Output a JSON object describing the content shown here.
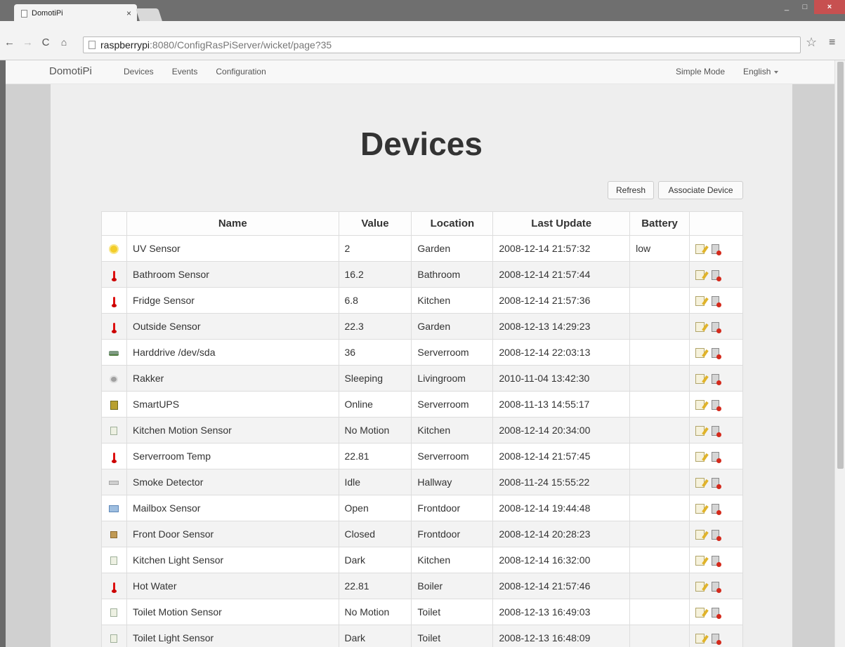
{
  "browser": {
    "tab_title": "DomotiPi",
    "tab_close": "×",
    "url_host": "raspberrypi",
    "url_rest": ":8080/ConfigRasPiServer/wicket/page?35",
    "window_close": "×",
    "window_minimize": "_",
    "window_maximize": "□"
  },
  "navbar": {
    "brand": "DomotiPi",
    "left_items": [
      "Devices",
      "Events",
      "Configuration"
    ],
    "simple_mode": "Simple Mode",
    "language": "English"
  },
  "page": {
    "title": "Devices",
    "refresh_label": "Refresh",
    "associate_label": "Associate Device"
  },
  "table": {
    "headers": {
      "name": "Name",
      "value": "Value",
      "location": "Location",
      "last_update": "Last Update",
      "battery": "Battery"
    },
    "rows": [
      {
        "icon": "sun-icon",
        "name": "UV Sensor",
        "value": "2",
        "location": "Garden",
        "last_update": "2008-12-14 21:57:32",
        "battery": "low"
      },
      {
        "icon": "thermometer-icon",
        "name": "Bathroom Sensor",
        "value": "16.2",
        "location": "Bathroom",
        "last_update": "2008-12-14 21:57:44",
        "battery": ""
      },
      {
        "icon": "thermometer-icon",
        "name": "Fridge Sensor",
        "value": "6.8",
        "location": "Kitchen",
        "last_update": "2008-12-14 21:57:36",
        "battery": ""
      },
      {
        "icon": "thermometer-icon",
        "name": "Outside Sensor",
        "value": "22.3",
        "location": "Garden",
        "last_update": "2008-12-13 14:29:23",
        "battery": ""
      },
      {
        "icon": "harddrive-icon",
        "name": "Harddrive /dev/sda",
        "value": "36",
        "location": "Serverroom",
        "last_update": "2008-12-14 22:03:13",
        "battery": ""
      },
      {
        "icon": "cat-icon",
        "name": "Rakker",
        "value": "Sleeping",
        "location": "Livingroom",
        "last_update": "2010-11-04 13:42:30",
        "battery": ""
      },
      {
        "icon": "ups-icon",
        "name": "SmartUPS",
        "value": "Online",
        "location": "Serverroom",
        "last_update": "2008-11-13 14:55:17",
        "battery": ""
      },
      {
        "icon": "motion-sensor-icon",
        "name": "Kitchen Motion Sensor",
        "value": "No Motion",
        "location": "Kitchen",
        "last_update": "2008-12-14 20:34:00",
        "battery": ""
      },
      {
        "icon": "thermometer-icon",
        "name": "Serverroom Temp",
        "value": "22.81",
        "location": "Serverroom",
        "last_update": "2008-12-14 21:57:45",
        "battery": ""
      },
      {
        "icon": "smoke-detector-icon",
        "name": "Smoke Detector",
        "value": "Idle",
        "location": "Hallway",
        "last_update": "2008-11-24 15:55:22",
        "battery": ""
      },
      {
        "icon": "mailbox-icon",
        "name": "Mailbox Sensor",
        "value": "Open",
        "location": "Frontdoor",
        "last_update": "2008-12-14 19:44:48",
        "battery": ""
      },
      {
        "icon": "door-icon",
        "name": "Front Door Sensor",
        "value": "Closed",
        "location": "Frontdoor",
        "last_update": "2008-12-14 20:28:23",
        "battery": ""
      },
      {
        "icon": "light-sensor-icon",
        "name": "Kitchen Light Sensor",
        "value": "Dark",
        "location": "Kitchen",
        "last_update": "2008-12-14 16:32:00",
        "battery": ""
      },
      {
        "icon": "thermometer-icon",
        "name": "Hot Water",
        "value": "22.81",
        "location": "Boiler",
        "last_update": "2008-12-14 21:57:46",
        "battery": ""
      },
      {
        "icon": "motion-sensor-icon",
        "name": "Toilet Motion Sensor",
        "value": "No Motion",
        "location": "Toilet",
        "last_update": "2008-12-13 16:49:03",
        "battery": ""
      },
      {
        "icon": "light-sensor-icon",
        "name": "Toilet Light Sensor",
        "value": "Dark",
        "location": "Toilet",
        "last_update": "2008-12-13 16:48:09",
        "battery": ""
      }
    ]
  }
}
